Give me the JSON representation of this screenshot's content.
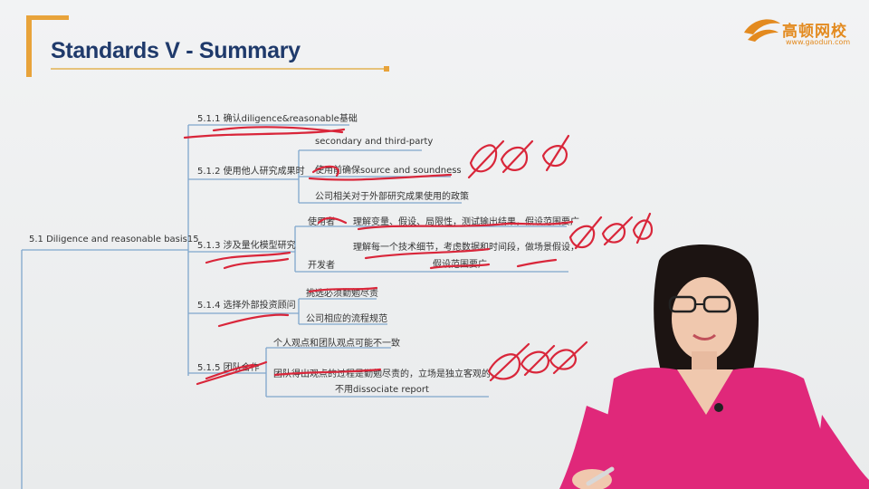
{
  "header": {
    "title": "Standards V - Summary",
    "logo_text": "高顿网校",
    "logo_url": "www.gaodun.com"
  },
  "mindmap": {
    "root": "5.1 Diligence and reasonable basis15",
    "n511": "5.1.1 确认diligence&reasonable基础",
    "n512": "5.1.2 使用他人研究成果时",
    "n512_a": "secondary and third-party",
    "n512_b": "使用前确保source and soundness",
    "n512_c": "公司相关对于外部研究成果使用的政策",
    "n513": "5.1.3 涉及量化模型研究",
    "n513_user": "使用者",
    "n513_user_text": "理解变量、假设、局限性，测试输出结果，假设范围要广",
    "n513_dev": "开发者",
    "n513_dev_text1": "理解每一个技术细节，考虑数据和时间段，做场景假设，",
    "n513_dev_text2": "假设范围要广",
    "n514": "5.1.4 选择外部投资顾问",
    "n514_a": "挑选必须勤勉尽责",
    "n514_b": "公司相应的流程规范",
    "n515": "5.1.5 团队合作",
    "n515_a": "个人观点和团队观点可能不一致",
    "n515_b1": "团队得出观点的过程是勤勉尽责的，立场是独立客观的，",
    "n515_b2": "不用dissociate report"
  },
  "colors": {
    "accent": "#e8a33a",
    "title": "#1f3a6b",
    "line": "#7fa6cc",
    "ink": "#d9263a",
    "shirt": "#e0287a"
  }
}
